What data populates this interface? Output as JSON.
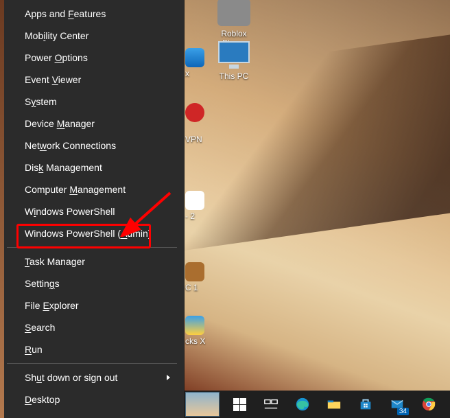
{
  "menu": {
    "groups": [
      [
        {
          "id": "apps-features",
          "label": "Apps and Features",
          "accel_index": 9,
          "submenu": false
        },
        {
          "id": "mobility-center",
          "label": "Mobility Center",
          "accel_index": 3,
          "submenu": false
        },
        {
          "id": "power-options",
          "label": "Power Options",
          "accel_index": 6,
          "submenu": false
        },
        {
          "id": "event-viewer",
          "label": "Event Viewer",
          "accel_index": 6,
          "submenu": false
        },
        {
          "id": "system",
          "label": "System",
          "accel_index": 1,
          "submenu": false
        },
        {
          "id": "device-manager",
          "label": "Device Manager",
          "accel_index": 7,
          "submenu": false
        },
        {
          "id": "network-connections",
          "label": "Network Connections",
          "accel_index": 3,
          "submenu": false
        },
        {
          "id": "disk-management",
          "label": "Disk Management",
          "accel_index": 3,
          "submenu": false
        },
        {
          "id": "computer-management",
          "label": "Computer Management",
          "accel_index": 9,
          "submenu": false
        },
        {
          "id": "powershell",
          "label": "Windows PowerShell",
          "accel_index": 1,
          "submenu": false
        },
        {
          "id": "powershell-admin",
          "label": "Windows PowerShell (Admin)",
          "accel_index": 20,
          "submenu": false,
          "highlighted": true
        }
      ],
      [
        {
          "id": "task-manager",
          "label": "Task Manager",
          "accel_index": 0,
          "submenu": false
        },
        {
          "id": "settings",
          "label": "Settings",
          "accel_index": 6,
          "submenu": false
        },
        {
          "id": "file-explorer",
          "label": "File Explorer",
          "accel_index": 5,
          "submenu": false
        },
        {
          "id": "search",
          "label": "Search",
          "accel_index": 0,
          "submenu": false
        },
        {
          "id": "run",
          "label": "Run",
          "accel_index": 0,
          "submenu": false
        }
      ],
      [
        {
          "id": "shutdown-signout",
          "label": "Shut down or sign out",
          "accel_index": 2,
          "submenu": true
        },
        {
          "id": "desktop",
          "label": "Desktop",
          "accel_index": 0,
          "submenu": false
        }
      ]
    ]
  },
  "desktop_icons": {
    "roblox": {
      "label": "Roblox Player"
    },
    "this_pc": {
      "label": "This PC"
    },
    "vpn": {
      "label_fragment": "VPN"
    },
    "item2": {
      "label_fragment": "- 2"
    },
    "item_c1": {
      "label_fragment": "C 1"
    },
    "item_ksx": {
      "label_fragment": "cks X"
    }
  },
  "taskbar": {
    "mail_badge": "34"
  },
  "annotation": {
    "target": "powershell-admin"
  }
}
